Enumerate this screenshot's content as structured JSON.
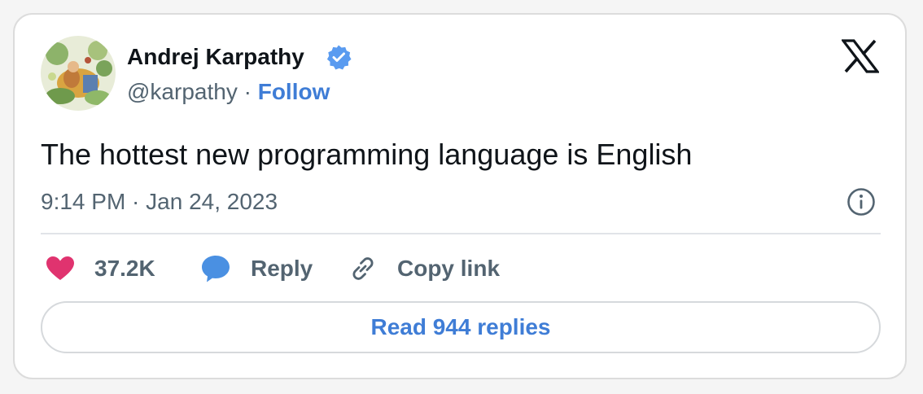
{
  "author": {
    "name": "Andrej Karpathy",
    "handle": "@karpathy",
    "separator": "·",
    "follow_label": "Follow",
    "verified": true
  },
  "platform_icon": "x-logo-icon",
  "tweet": {
    "text": "The hottest new programming language is English",
    "timestamp": "9:14 PM · Jan 24, 2023"
  },
  "actions": {
    "likes_count": "37.2K",
    "reply_label": "Reply",
    "copy_link_label": "Copy link"
  },
  "read_replies_label": "Read 944 replies",
  "colors": {
    "accent": "#3f7dd6",
    "like": "#e0336f",
    "reply_icon": "#4a90e2",
    "muted_text": "#536471",
    "verified_badge": "#5a9bf0"
  }
}
